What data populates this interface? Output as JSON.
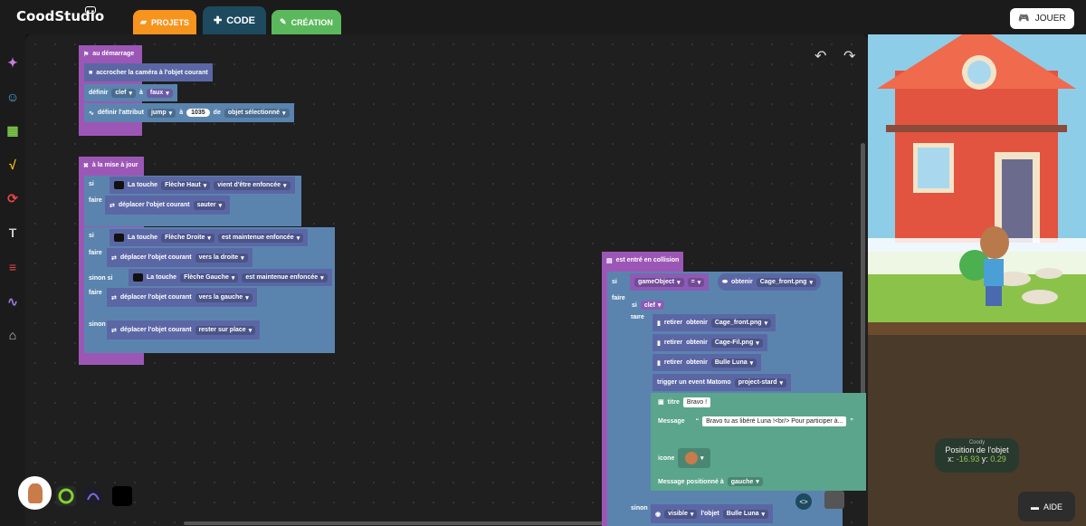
{
  "app": {
    "logo": "CoodStudio"
  },
  "tabs": {
    "projets": "PROJETS",
    "code": "CODE",
    "creation": "CRÉATION"
  },
  "play_button": "JOUER",
  "help_button": "AIDE",
  "rail_icons": [
    "magic-wand-icon",
    "smiley-icon",
    "chip-icon",
    "math-icon",
    "loop-icon",
    "text-icon",
    "list-icon",
    "function-icon",
    "bridge-icon"
  ],
  "colors": {
    "accent_orange": "#f7941d",
    "accent_green": "#5cb85c",
    "code_tab": "#1d4a5e"
  },
  "blocks": {
    "start": {
      "header": "au démarrage",
      "camera": "accrocher la caméra à l'objet courant",
      "define_label": "définir",
      "define_var": "clef",
      "define_to": "à",
      "define_val": "faux",
      "attr_label": "définir l'attribut",
      "attr_name": "jump",
      "attr_to": "à",
      "attr_value": "1035",
      "attr_of": "de",
      "attr_target": "objet sélectionné"
    },
    "update": {
      "header": "à la mise à jour",
      "if_label": "si",
      "do_label": "faire",
      "elseif_label": "sinon si",
      "else_label": "sinon",
      "key_label": "La touche",
      "key1": "Flèche Haut",
      "state1": "vient d'être enfoncée",
      "move_label": "déplacer l'objet courant",
      "action1": "sauter",
      "key2": "Flèche Droite",
      "state2": "est maintenue enfoncée",
      "action2": "vers la droite",
      "key3": "Flèche Gauche",
      "state3": "est maintenue enfoncée",
      "action3": "vers la gauche",
      "action4": "rester sur place"
    },
    "collision": {
      "header": "est entré en collision",
      "if_label": "si",
      "do_label": "faire",
      "else_label": "sinon",
      "game_object": "gameObject",
      "equals": "=",
      "get_label": "obtenir",
      "get_value": "Cage_front.png",
      "cond_var": "clef",
      "remove_label": "retirer",
      "remove1": "Cage_front.png",
      "remove2": "Cage-Fil.png",
      "remove3": "Bulle Luna",
      "trigger_label": "trigger un event Matomo",
      "trigger_value": "project-stard",
      "title_label": "titre",
      "title_value": "Bravo !",
      "message_label": "Message",
      "message_value": "Bravo tu as libéré Luna !<br/> Pour participer à...",
      "icon_label": "icone",
      "position_label": "Message positionné à",
      "position_value": "gauche",
      "visible_label": "visible",
      "of_object": "l'objet",
      "visible_target": "Bulle Luna"
    }
  },
  "preview": {
    "caption": "Coody",
    "position_title": "Position de l'objet",
    "x_label": "x:",
    "x_value": "-16.93",
    "y_label": "y:",
    "y_value": "0.29"
  }
}
